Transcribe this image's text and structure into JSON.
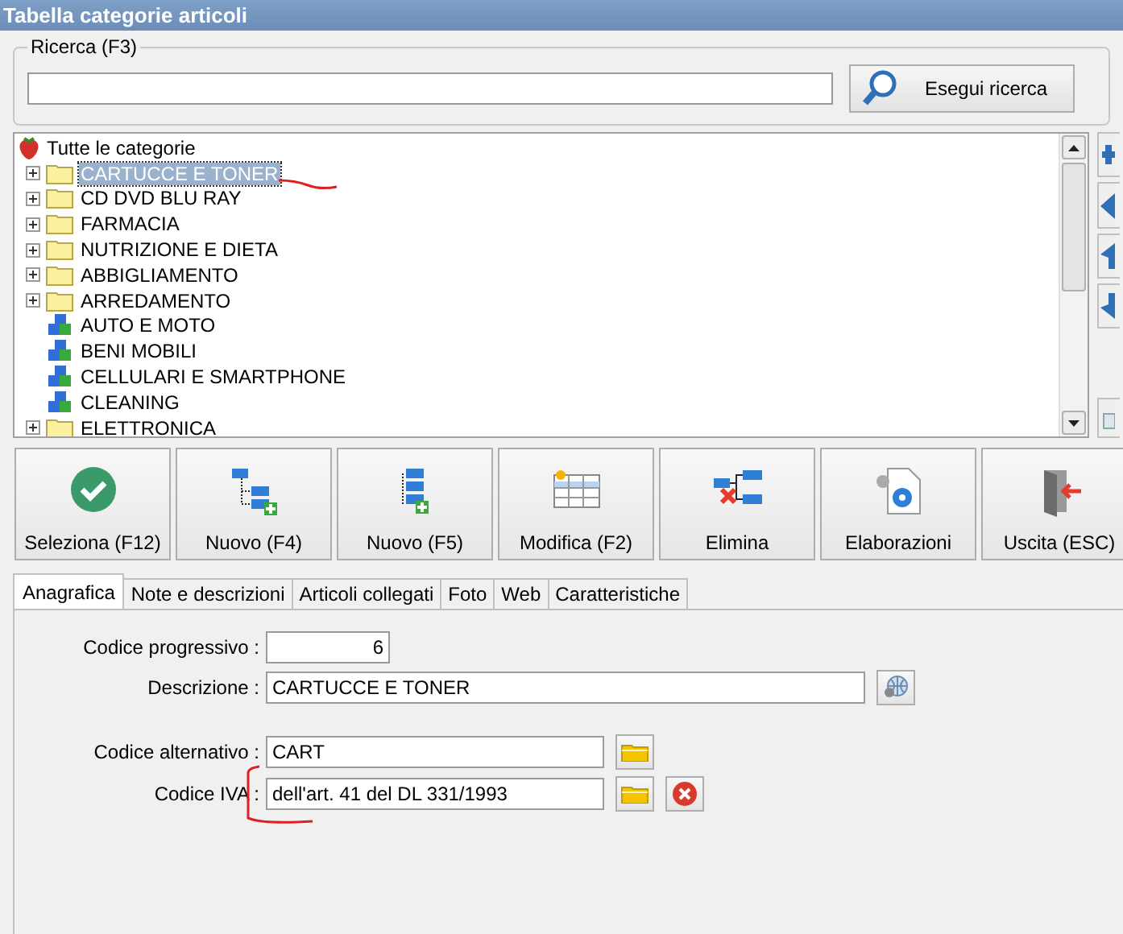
{
  "window": {
    "title": "Tabella categorie articoli"
  },
  "search": {
    "legend": "Ricerca (F3)",
    "button": "Esegui ricerca"
  },
  "tree": {
    "label": "Tutte le categorie",
    "children": [
      {
        "label": "CARTUCCE E TONER",
        "kind": "folder",
        "expanded": false,
        "selected": true
      },
      {
        "label": "CD DVD BLU RAY",
        "kind": "folder",
        "expanded": false,
        "selected": false
      },
      {
        "label": "FARMACIA",
        "kind": "folder",
        "expanded": false,
        "selected": false
      },
      {
        "label": "NUTRIZIONE E DIETA",
        "kind": "folder",
        "expanded": false,
        "selected": false
      },
      {
        "label": "ABBIGLIAMENTO",
        "kind": "folder",
        "expanded": false,
        "selected": false
      },
      {
        "label": "ARREDAMENTO",
        "kind": "folder",
        "expanded": false,
        "selected": false
      },
      {
        "label": "AUTO E MOTO",
        "kind": "item",
        "selected": false
      },
      {
        "label": "BENI MOBILI",
        "kind": "item",
        "selected": false
      },
      {
        "label": "CELLULARI E SMARTPHONE",
        "kind": "item",
        "selected": false
      },
      {
        "label": "CLEANING",
        "kind": "item",
        "selected": false
      },
      {
        "label": "ELETTRONICA",
        "kind": "folder",
        "expanded": false,
        "selected": false
      }
    ]
  },
  "toolbar": [
    {
      "label": "Seleziona (F12)",
      "kind": "check"
    },
    {
      "label": "Nuovo (F4)",
      "kind": "tree-add"
    },
    {
      "label": "Nuovo (F5)",
      "kind": "list-add"
    },
    {
      "label": "Modifica (F2)",
      "kind": "grid-edit"
    },
    {
      "label": "Elimina",
      "kind": "tree-delete"
    },
    {
      "label": "Elaborazioni",
      "kind": "document-gear"
    },
    {
      "label": "Uscita (ESC)",
      "kind": "exit"
    }
  ],
  "tabs": [
    {
      "label": "Anagrafica",
      "selected": true
    },
    {
      "label": "Note e descrizioni",
      "selected": false
    },
    {
      "label": "Articoli collegati",
      "selected": false
    },
    {
      "label": "Foto",
      "selected": false
    },
    {
      "label": "Web",
      "selected": false
    },
    {
      "label": "Caratteristiche",
      "selected": false
    }
  ],
  "field_groups": [
    [
      {
        "label": "Codice progressivo :",
        "value": "6",
        "kind": "number"
      },
      {
        "label": "Descrizione :",
        "value": "CARTUCCE E TONER",
        "kind": "wide",
        "actions": [
          {
            "kind": "globe"
          }
        ]
      }
    ],
    [
      {
        "label": "Codice alternativo :",
        "value": "CART",
        "kind": "medium",
        "actions": [
          {
            "kind": "folder"
          }
        ]
      },
      {
        "label": "Codice IVA :",
        "value": "dell'art. 41 del DL 331/1993",
        "kind": "medium",
        "actions": [
          {
            "kind": "folder"
          },
          {
            "kind": "delete"
          }
        ]
      }
    ]
  ]
}
